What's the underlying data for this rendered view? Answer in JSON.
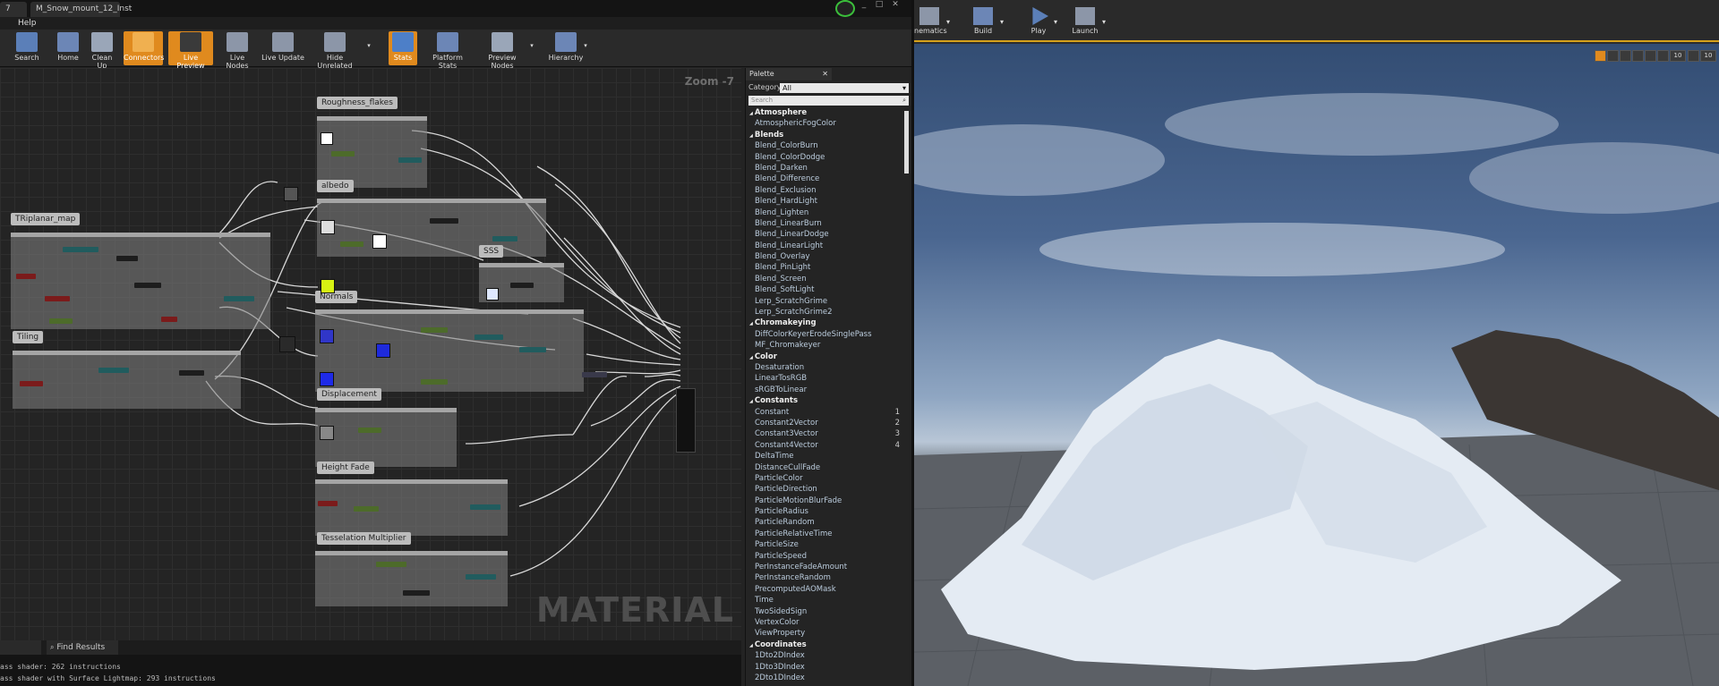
{
  "window": {
    "tabs": [
      "7",
      "M_Snow_mount_12_Inst"
    ]
  },
  "menu": {
    "help": "Help"
  },
  "toolbar": {
    "buttons": [
      "Search",
      "Home",
      "Clean Up",
      "Connectors",
      "Live Preview",
      "Live Nodes",
      "Live Update",
      "Hide Unrelated",
      "Stats",
      "Platform Stats",
      "Preview Nodes",
      "Hierarchy"
    ]
  },
  "graph": {
    "zoom": "Zoom -7",
    "watermark": "MATERIAL",
    "comments": [
      "Roughness_flakes",
      "albedo",
      "TRiplanar_map",
      "SSS",
      "Normals",
      "Tiling",
      "Displacement",
      "Height Fade",
      "Tesselation Multiplier"
    ]
  },
  "bottom": {
    "tab": "Find Results",
    "log": [
      "ass shader: 262 instructions",
      "ass shader with Surface Lightmap: 293 instructions"
    ]
  },
  "palette": {
    "title": "Palette",
    "category_label": "Category",
    "category_value": "All",
    "search_placeholder": "Search",
    "items": [
      {
        "t": "c",
        "label": "Atmosphere"
      },
      {
        "t": "i",
        "label": "AtmosphericFogColor"
      },
      {
        "t": "c",
        "label": "Blends"
      },
      {
        "t": "i",
        "label": "Blend_ColorBurn"
      },
      {
        "t": "i",
        "label": "Blend_ColorDodge"
      },
      {
        "t": "i",
        "label": "Blend_Darken"
      },
      {
        "t": "i",
        "label": "Blend_Difference"
      },
      {
        "t": "i",
        "label": "Blend_Exclusion"
      },
      {
        "t": "i",
        "label": "Blend_HardLight"
      },
      {
        "t": "i",
        "label": "Blend_Lighten"
      },
      {
        "t": "i",
        "label": "Blend_LinearBurn"
      },
      {
        "t": "i",
        "label": "Blend_LinearDodge"
      },
      {
        "t": "i",
        "label": "Blend_LinearLight"
      },
      {
        "t": "i",
        "label": "Blend_Overlay"
      },
      {
        "t": "i",
        "label": "Blend_PinLight"
      },
      {
        "t": "i",
        "label": "Blend_Screen"
      },
      {
        "t": "i",
        "label": "Blend_SoftLight"
      },
      {
        "t": "i",
        "label": "Lerp_ScratchGrime"
      },
      {
        "t": "i",
        "label": "Lerp_ScratchGrime2"
      },
      {
        "t": "c",
        "label": "Chromakeying"
      },
      {
        "t": "i",
        "label": "DiffColorKeyerErodeSinglePass"
      },
      {
        "t": "i",
        "label": "MF_Chromakeyer"
      },
      {
        "t": "c",
        "label": "Color"
      },
      {
        "t": "i",
        "label": "Desaturation"
      },
      {
        "t": "i",
        "label": "LinearTosRGB"
      },
      {
        "t": "i",
        "label": "sRGBToLinear"
      },
      {
        "t": "c",
        "label": "Constants"
      },
      {
        "t": "i",
        "label": "Constant",
        "num": "1"
      },
      {
        "t": "i",
        "label": "Constant2Vector",
        "num": "2"
      },
      {
        "t": "i",
        "label": "Constant3Vector",
        "num": "3"
      },
      {
        "t": "i",
        "label": "Constant4Vector",
        "num": "4"
      },
      {
        "t": "i",
        "label": "DeltaTime"
      },
      {
        "t": "i",
        "label": "DistanceCullFade"
      },
      {
        "t": "i",
        "label": "ParticleColor"
      },
      {
        "t": "i",
        "label": "ParticleDirection"
      },
      {
        "t": "i",
        "label": "ParticleMotionBlurFade"
      },
      {
        "t": "i",
        "label": "ParticleRadius"
      },
      {
        "t": "i",
        "label": "ParticleRandom"
      },
      {
        "t": "i",
        "label": "ParticleRelativeTime"
      },
      {
        "t": "i",
        "label": "ParticleSize"
      },
      {
        "t": "i",
        "label": "ParticleSpeed"
      },
      {
        "t": "i",
        "label": "PerInstanceFadeAmount"
      },
      {
        "t": "i",
        "label": "PerInstanceRandom"
      },
      {
        "t": "i",
        "label": "PrecomputedAOMask"
      },
      {
        "t": "i",
        "label": "Time"
      },
      {
        "t": "i",
        "label": "TwoSidedSign"
      },
      {
        "t": "i",
        "label": "VertexColor"
      },
      {
        "t": "i",
        "label": "ViewProperty"
      },
      {
        "t": "c",
        "label": "Coordinates"
      },
      {
        "t": "i",
        "label": "1Dto2DIndex"
      },
      {
        "t": "i",
        "label": "1Dto3DIndex"
      },
      {
        "t": "i",
        "label": "2Dto1DIndex"
      }
    ]
  },
  "viewport_toolbar": {
    "buttons": [
      "nematics",
      "Build",
      "Play",
      "Launch"
    ]
  },
  "viewport_icons": [
    "10",
    "10"
  ],
  "colors": {
    "accent": "#e08a1e",
    "selection": "#d6a21b"
  }
}
